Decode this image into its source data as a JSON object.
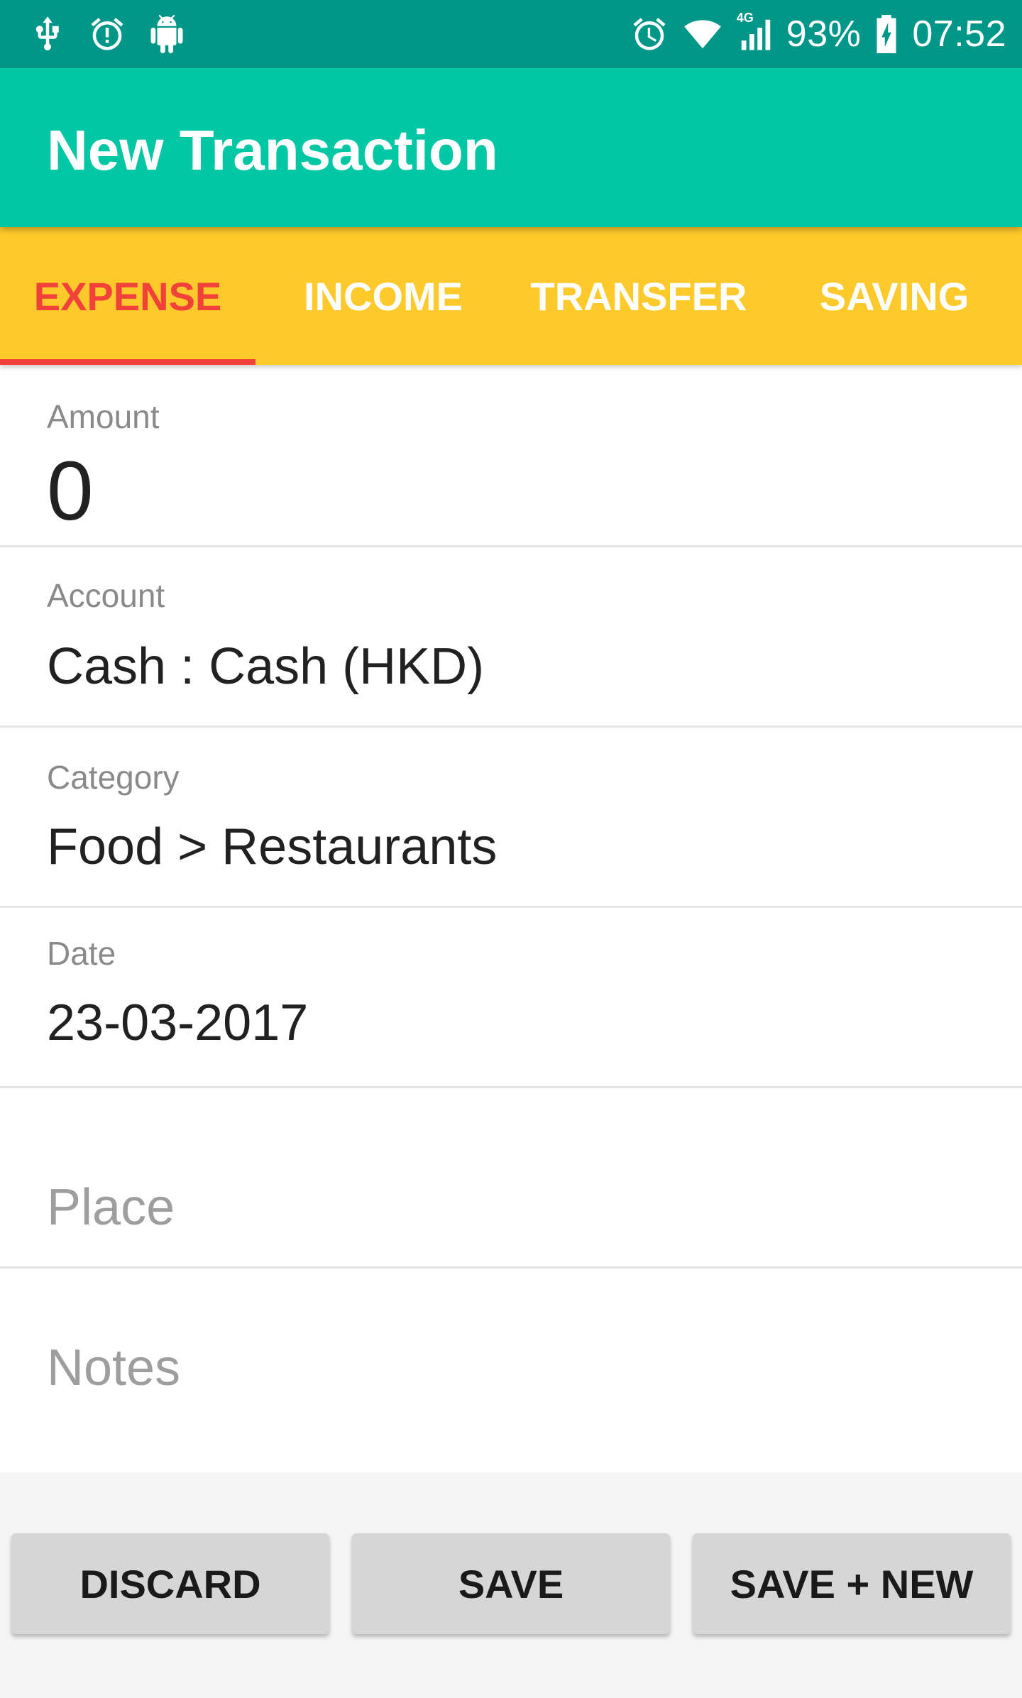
{
  "status_bar": {
    "left_icons": [
      "usb-icon",
      "alarm-warning-icon",
      "android-debug-icon"
    ],
    "right_icons": [
      "alarm-icon",
      "wifi-icon",
      "signal-4g-icon"
    ],
    "network_label": "4G",
    "battery": "93%",
    "time": "07:52",
    "background": "#009688"
  },
  "app_bar": {
    "title": "New Transaction",
    "background": "#02C7A4"
  },
  "tabs": {
    "items": [
      {
        "label": "EXPENSE",
        "active": true
      },
      {
        "label": "INCOME",
        "active": false
      },
      {
        "label": "TRANSFER",
        "active": false
      },
      {
        "label": "SAVING",
        "active": false
      }
    ],
    "background": "#FDC92B",
    "active_color": "#F2403A"
  },
  "form": {
    "amount": {
      "label": "Amount",
      "value": "0"
    },
    "account": {
      "label": "Account",
      "value": "Cash : Cash (HKD)"
    },
    "category": {
      "label": "Category",
      "value": "Food > Restaurants"
    },
    "date": {
      "label": "Date",
      "value": "23-03-2017"
    },
    "place": {
      "placeholder": "Place"
    },
    "notes": {
      "placeholder": "Notes"
    }
  },
  "buttons": {
    "discard": "DISCARD",
    "save": "SAVE",
    "save_new": "SAVE + NEW"
  }
}
